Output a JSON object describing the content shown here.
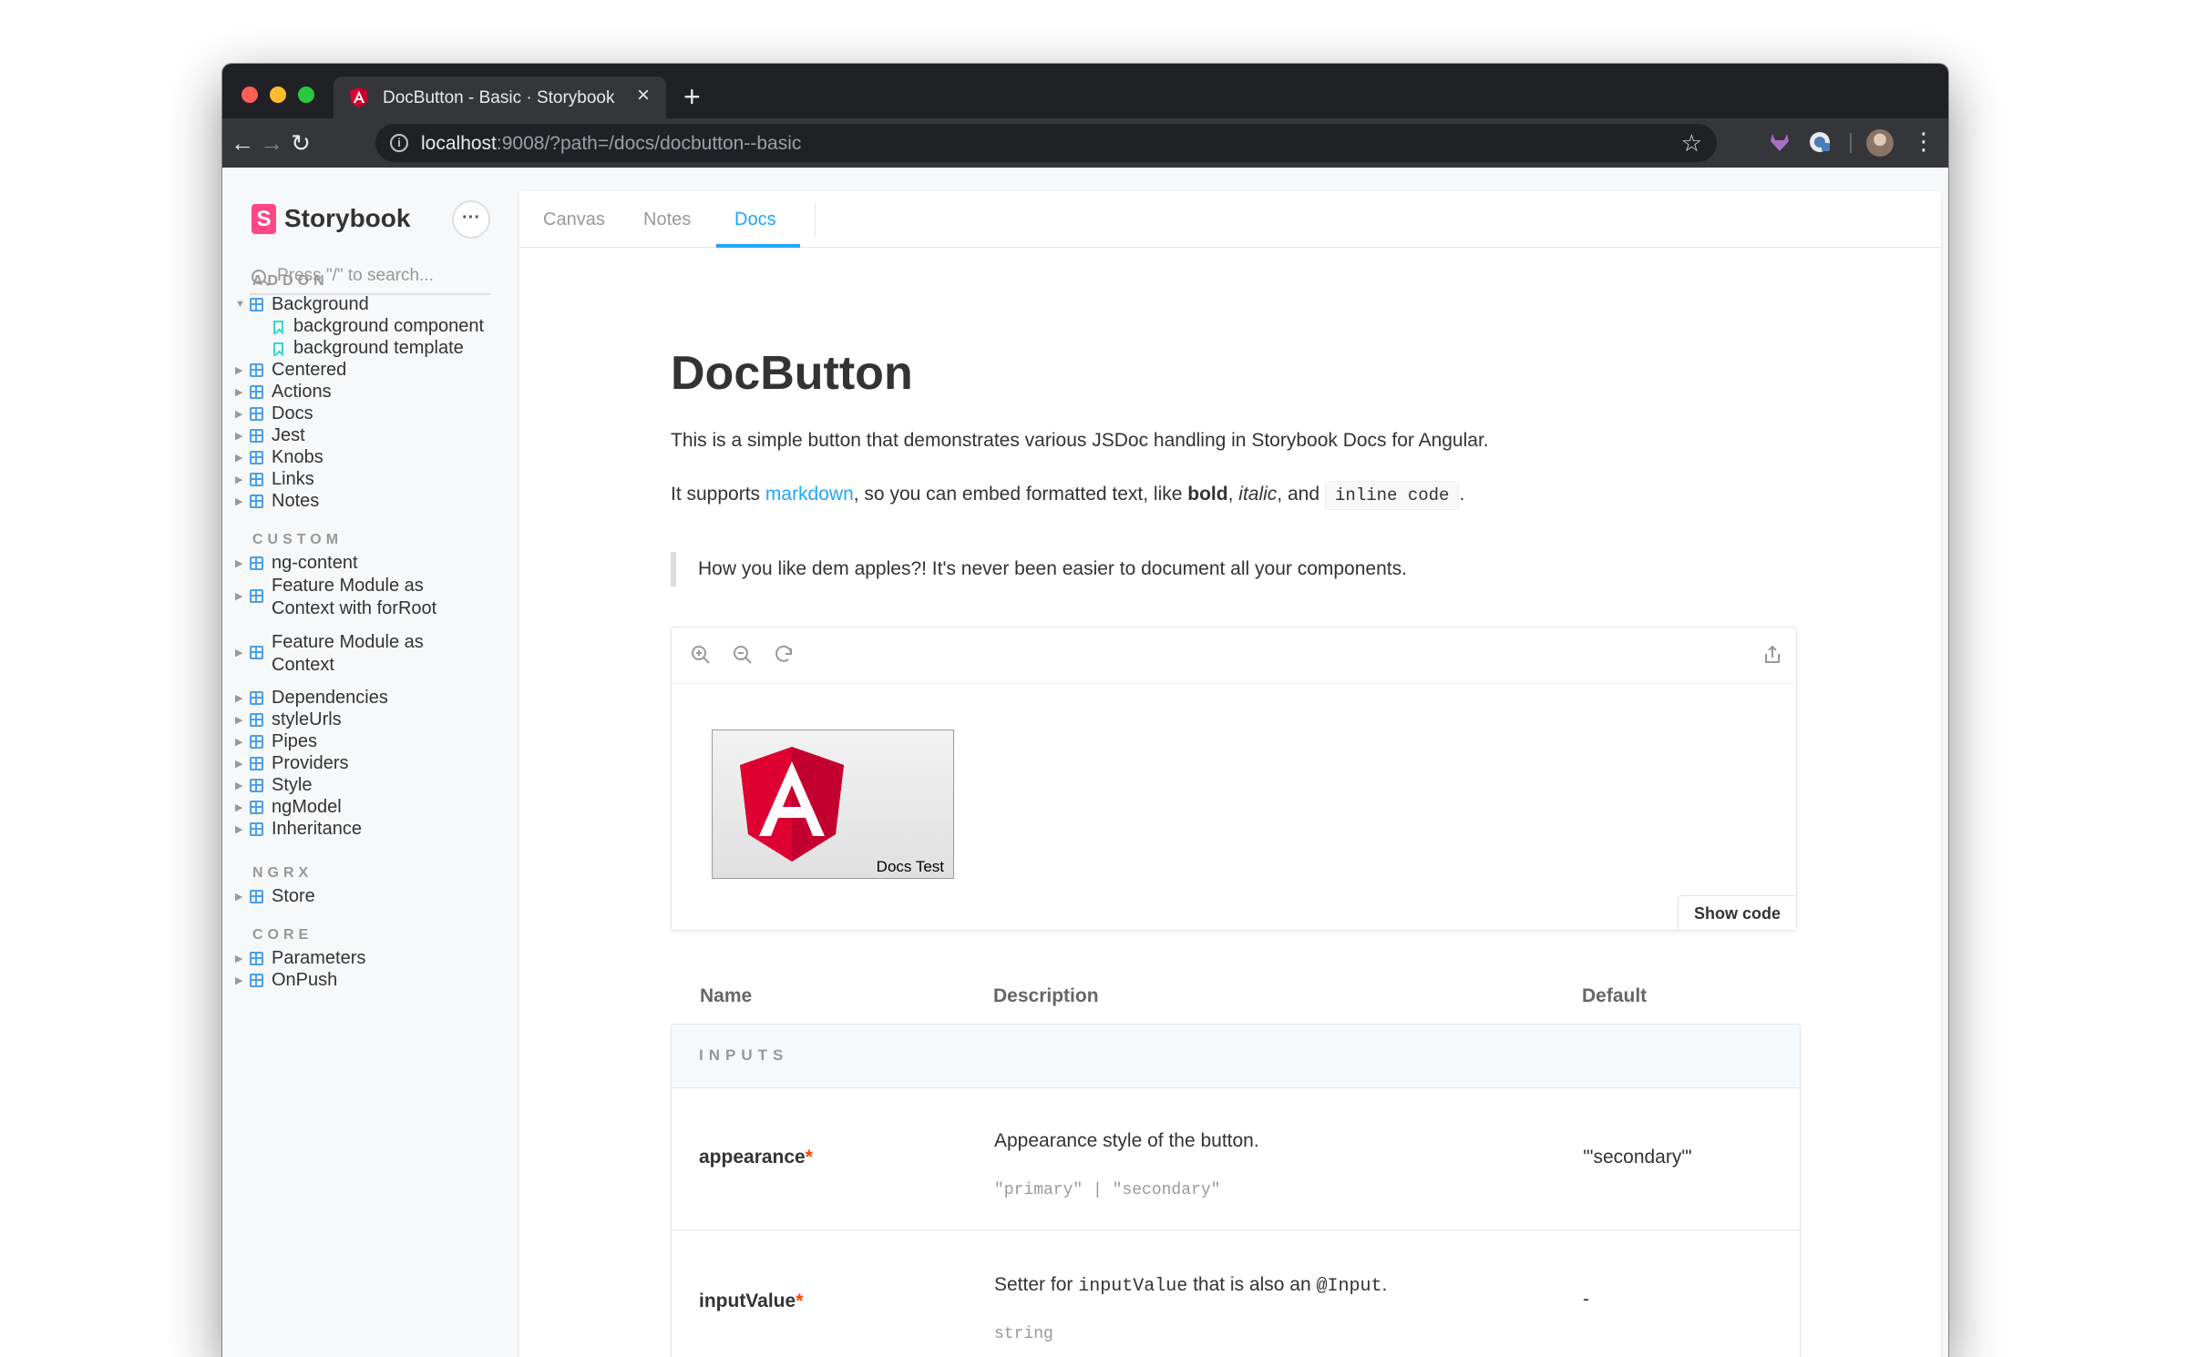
{
  "browser": {
    "tab_title": "DocButton - Basic · Storybook",
    "url_host": "localhost",
    "url_rest": ":9008/?path=/docs/docbutton--basic"
  },
  "sidebar": {
    "brand": "Storybook",
    "search_placeholder": "Press \"/\" to search...",
    "sections": [
      {
        "title": "ADDON",
        "items": [
          {
            "label": "Background"
          },
          {
            "label": "background component"
          },
          {
            "label": "background template"
          },
          {
            "label": "Centered"
          },
          {
            "label": "Actions"
          },
          {
            "label": "Docs"
          },
          {
            "label": "Jest"
          },
          {
            "label": "Knobs"
          },
          {
            "label": "Links"
          },
          {
            "label": "Notes"
          }
        ]
      },
      {
        "title": "CUSTOM",
        "items": [
          {
            "label": "ng-content"
          },
          {
            "label": "Feature Module as Context with forRoot"
          },
          {
            "label": "Feature Module as Context"
          },
          {
            "label": "Dependencies"
          },
          {
            "label": "styleUrls"
          },
          {
            "label": "Pipes"
          },
          {
            "label": "Providers"
          },
          {
            "label": "Style"
          },
          {
            "label": "ngModel"
          },
          {
            "label": "Inheritance"
          }
        ]
      },
      {
        "title": "NGRX",
        "items": [
          {
            "label": "Store"
          }
        ]
      },
      {
        "title": "CORE",
        "items": [
          {
            "label": "Parameters"
          },
          {
            "label": "OnPush"
          }
        ]
      }
    ]
  },
  "panel_tabs": [
    "Canvas",
    "Notes",
    "Docs"
  ],
  "doc": {
    "title": "DocButton",
    "intro": "This is a simple button that demonstrates various JSDoc handling in Storybook Docs for Angular.",
    "p2_a": "It supports ",
    "p2_link": "markdown",
    "p2_b": ", so you can embed formatted text, like ",
    "p2_bold": "bold",
    "p2_c": ", ",
    "p2_italic": "italic",
    "p2_d": ", and",
    "p2_code": "inline code",
    "p2_e": ".",
    "quote": "How you like dem apples?! It's never been easier to document all your components.",
    "demo_caption": "Docs Test",
    "show_code": "Show code"
  },
  "props": {
    "headers": [
      "Name",
      "Description",
      "Default"
    ],
    "section": "INPUTS",
    "rows": [
      {
        "name": "appearance",
        "required": "*",
        "description": "Appearance style of the button.",
        "type": "\"primary\" | \"secondary\"",
        "default": "'\"secondary\"'"
      },
      {
        "name": "inputValue",
        "required": "*",
        "desc_a": "Setter for ",
        "desc_code1": "inputValue",
        "desc_b": " that is also an ",
        "desc_code2": "@Input",
        "desc_c": ".",
        "type": "string",
        "default": "-"
      }
    ]
  }
}
